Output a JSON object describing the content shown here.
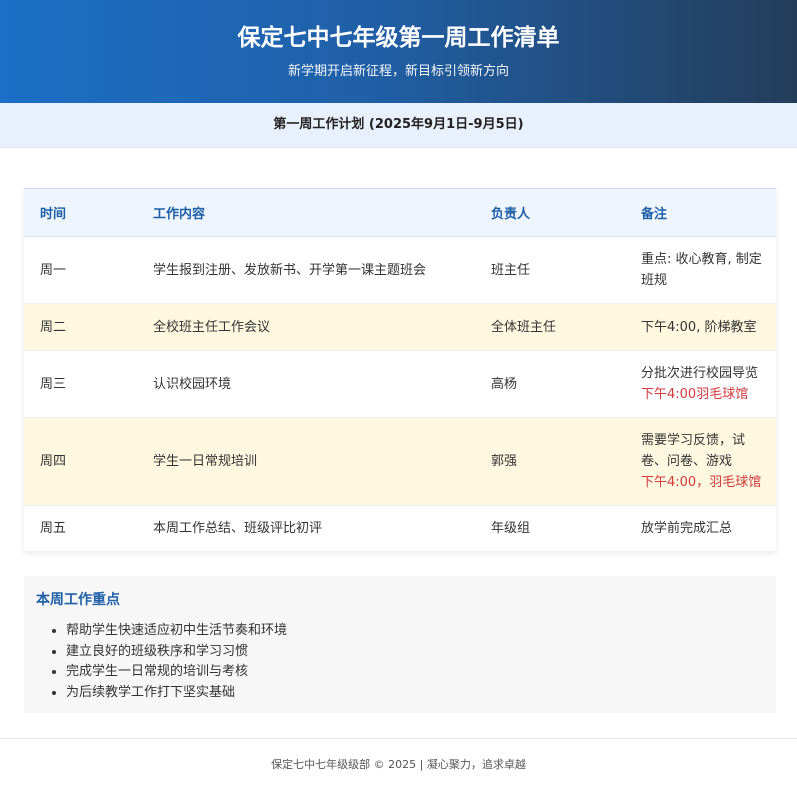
{
  "header": {
    "title": "保定七中七年级第一周工作清单",
    "subtitle": "新学期开启新征程，新目标引领新方向"
  },
  "plan_title": "第一周工作计划 (2025年9月1日-9月5日)",
  "table": {
    "headers": [
      "时间",
      "工作内容",
      "负责人",
      "备注"
    ],
    "rows": [
      {
        "day": "周一",
        "content": "学生报到注册、发放新书、开学第一课主题班会",
        "owner": "班主任",
        "note": "重点: 收心教育, 制定班规",
        "note_red": ""
      },
      {
        "day": "周二",
        "content": "全校班主任工作会议",
        "owner": "全体班主任",
        "note": "下午4:00, 阶梯教室",
        "note_red": ""
      },
      {
        "day": "周三",
        "content": "认识校园环境",
        "owner": "高杨",
        "note": "分批次进行校园导览",
        "note_red": "下午4:00羽毛球馆"
      },
      {
        "day": "周四",
        "content": "学生一日常规培训",
        "owner": "郭强",
        "note": "需要学习反馈，试卷、问卷、游戏",
        "note_red": "下午4:00，羽毛球馆"
      },
      {
        "day": "周五",
        "content": "本周工作总结、班级评比初评",
        "owner": "年级组",
        "note": "放学前完成汇总",
        "note_red": ""
      }
    ]
  },
  "focus": {
    "title": "本周工作重点",
    "items": [
      "帮助学生快速适应初中生活节奏和环境",
      "建立良好的班级秩序和学习习惯",
      "完成学生一日常规的培训与考核",
      "为后续教学工作打下坚实基础"
    ]
  },
  "footer": "保定七中七年级级部 © 2025 | 凝心聚力，追求卓越"
}
